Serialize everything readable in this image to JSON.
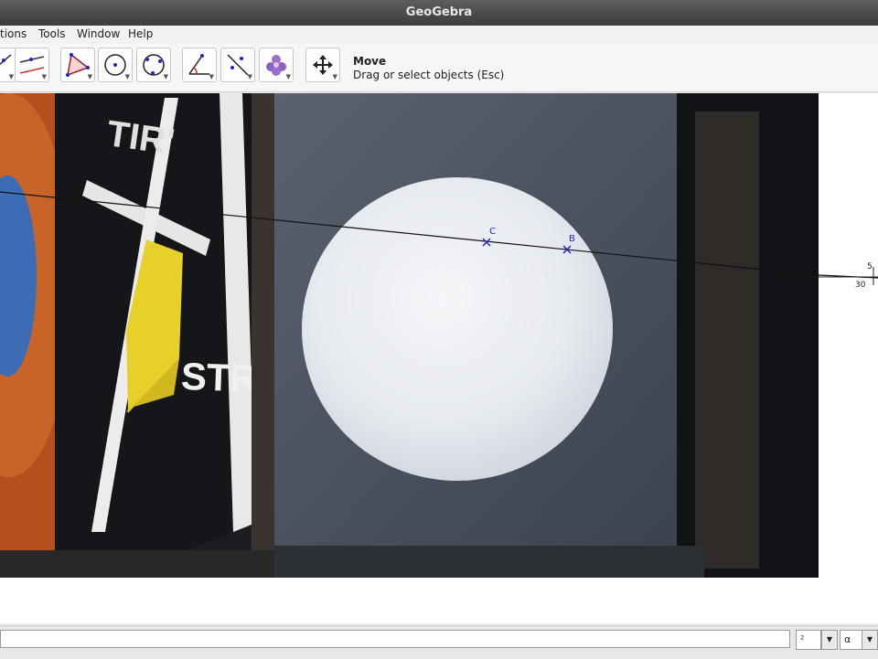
{
  "window": {
    "title": "GeoGebra"
  },
  "menubar": {
    "items": [
      "tions",
      "Tools",
      "Window",
      "Help"
    ]
  },
  "toolbar": {
    "tool_icons": [
      "line-tool-icon",
      "parallel-lines-tool-icon",
      "polygon-tool-icon",
      "circle-center-point-icon",
      "circle-three-points-icon",
      "angle-tool-icon",
      "reflect-tool-icon",
      "slider-tool-icon",
      "move-graphics-view-icon"
    ],
    "active_tool_name": "Move",
    "active_tool_description": "Drag or select objects (Esc)"
  },
  "graphics": {
    "points": [
      {
        "label": "C"
      },
      {
        "label": "B"
      }
    ],
    "axis_labels": {
      "x_tick": "30",
      "y_tick": "5"
    }
  },
  "input_bar": {
    "input_value": "",
    "symbol_combo_value": "²",
    "greek_combo_value": "α"
  },
  "colors": {
    "point": "#2222cc",
    "line": "#111111",
    "titlebar": "#4a4a4a"
  }
}
